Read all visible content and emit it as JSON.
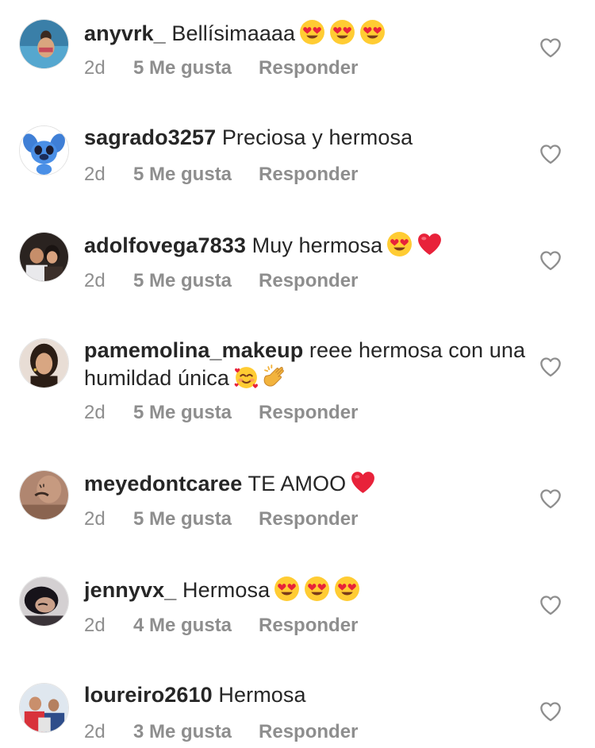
{
  "comments": [
    {
      "username": "anyvrk_",
      "text": "Bellísimaaaa",
      "emojis": [
        "heart-eyes",
        "heart-eyes",
        "heart-eyes"
      ],
      "time": "2d",
      "likes": "5 Me gusta",
      "reply": "Responder",
      "avatar": "avatar-photo-pool"
    },
    {
      "username": "sagrado3257",
      "text": "Preciosa y hermosa",
      "emojis": [],
      "time": "2d",
      "likes": "5 Me gusta",
      "reply": "Responder",
      "avatar": "avatar-blue-cartoon"
    },
    {
      "username": "adolfovega7833",
      "text": "Muy hermosa",
      "emojis": [
        "heart-eyes",
        "red-heart"
      ],
      "time": "2d",
      "likes": "5 Me gusta",
      "reply": "Responder",
      "avatar": "avatar-photo-couple"
    },
    {
      "username": "pamemolina_makeup",
      "text": "reee hermosa con una humildad única",
      "emojis": [
        "smiling-hearts",
        "clapping-hands"
      ],
      "time": "2d",
      "likes": "5 Me gusta",
      "reply": "Responder",
      "avatar": "avatar-photo-woman"
    },
    {
      "username": "meyedontcaree",
      "text": "TE AMOO",
      "emojis": [
        "red-heart"
      ],
      "time": "2d",
      "likes": "5 Me gusta",
      "reply": "Responder",
      "avatar": "avatar-photo-tattoo"
    },
    {
      "username": "jennyvx_",
      "text": "Hermosa",
      "emojis": [
        "heart-eyes",
        "heart-eyes",
        "heart-eyes"
      ],
      "time": "2d",
      "likes": "4 Me gusta",
      "reply": "Responder",
      "avatar": "avatar-photo-selfie"
    },
    {
      "username": "loureiro2610",
      "text": "Hermosa",
      "emojis": [],
      "time": "2d",
      "likes": "3 Me gusta",
      "reply": "Responder",
      "avatar": "avatar-photo-group"
    }
  ],
  "colors": {
    "text": "#262626",
    "meta": "#8e8e8e",
    "heart_outline": "#8e8e8e",
    "emoji_yellow": "#ffcc33",
    "emoji_red": "#e8223a"
  }
}
